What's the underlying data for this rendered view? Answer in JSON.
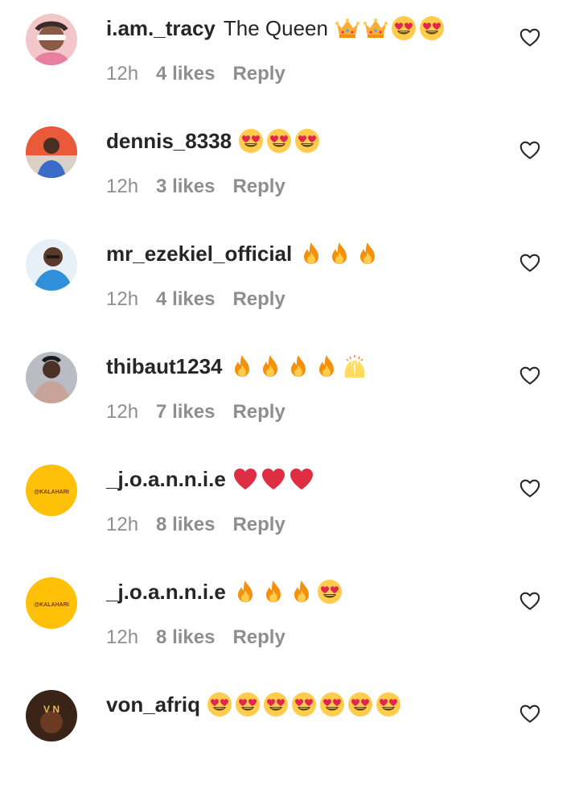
{
  "comments": [
    {
      "username": "i.am._tracy",
      "text": "The Queen",
      "emojis": [
        "crown",
        "crown",
        "heart-eyes",
        "heart-eyes"
      ],
      "time": "12h",
      "likes": "4 likes",
      "reply": "Reply",
      "avatar": "photo-pink"
    },
    {
      "username": "dennis_8338",
      "text": "",
      "emojis": [
        "heart-eyes",
        "heart-eyes",
        "heart-eyes"
      ],
      "time": "12h",
      "likes": "3 likes",
      "reply": "Reply",
      "avatar": "photo-red"
    },
    {
      "username": "mr_ezekiel_official",
      "text": "",
      "emojis": [
        "fire",
        "fire",
        "fire"
      ],
      "time": "12h",
      "likes": "4 likes",
      "reply": "Reply",
      "avatar": "photo-blue"
    },
    {
      "username": "thibaut1234",
      "text": "",
      "emojis": [
        "fire",
        "fire",
        "fire",
        "fire",
        "raising-hands"
      ],
      "time": "12h",
      "likes": "7 likes",
      "reply": "Reply",
      "avatar": "photo-gray"
    },
    {
      "username": "_j.o.a.n.n.i.e",
      "text": "",
      "emojis": [
        "red-heart",
        "red-heart",
        "red-heart"
      ],
      "time": "12h",
      "likes": "8 likes",
      "reply": "Reply",
      "avatar": "kalahari-logo"
    },
    {
      "username": "_j.o.a.n.n.i.e",
      "text": "",
      "emojis": [
        "fire",
        "fire",
        "fire",
        "heart-eyes"
      ],
      "time": "12h",
      "likes": "8 likes",
      "reply": "Reply",
      "avatar": "kalahari-logo"
    },
    {
      "username": "von_afriq",
      "text": "",
      "emojis": [
        "heart-eyes",
        "heart-eyes",
        "heart-eyes",
        "heart-eyes",
        "heart-eyes",
        "heart-eyes",
        "heart-eyes"
      ],
      "time": "",
      "likes": "",
      "reply": "",
      "avatar": "photo-dark"
    }
  ],
  "avatar_logo_text": "@KALAHARI",
  "colors": {
    "text": "#262626",
    "meta": "#8e8e8e",
    "background": "#ffffff"
  }
}
